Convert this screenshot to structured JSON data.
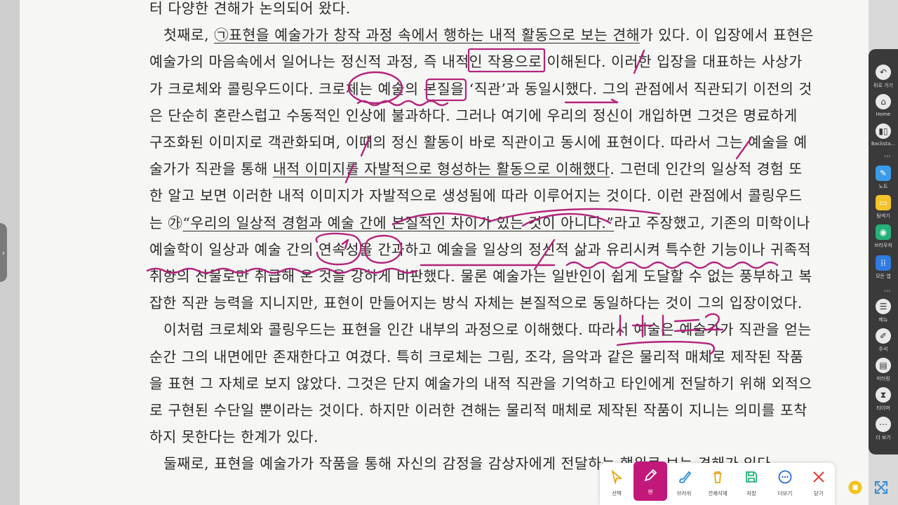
{
  "document": {
    "paragraphs": [
      {
        "id": "p0",
        "indent": false,
        "segments": [
          {
            "text": "터 다양한 견해가 논의되어 왔다."
          }
        ]
      },
      {
        "id": "p1",
        "indent": true,
        "segments": [
          {
            "text": "첫째로, "
          },
          {
            "text": "㉠표현을 예술가가 창작 과정 속에서 행하는 내적 활동으로 보는 견해",
            "underline": true
          },
          {
            "text": "가 있다. 이 입장에서 표현은 예술가의 마음속에서 일어나는 정신적 과정, 즉 내적인 작용으로 이해된다. 이러한 입장을 대표하는 사상가가 크로체와 콜링우드이다. 크로체는 예술의 본질을 ‘직관’과 동일시했다. 그의 관점에서 직관되기 이전의 것은 단순히 혼란스럽고 수동적인 인상에 불과하다. 그러나 여기에 우리의 정신이 개입하면 그것은 명료하게 구조화된 이미지로 객관화되며, 이때의 정신 활동이 바로 직관이고 동시에 표현이다. 따라서 그는 예술을 예술가가 직관을 통해 "
          },
          {
            "text": "내적 이미지를 자발적으로 형성하는 활동으로 이해했다",
            "underline": true
          },
          {
            "text": ". 그런데 인간의 일상적 경험 또한 알고 보면 이러한 내적 이미지가 자발적으로 생성됨에 따라 이루어지는 것이다. 이런 관점에서 콜링우드는 ㉮"
          },
          {
            "text": "“우리의 일상적 경험과 예술 간에 본질적인 차이가 있는 것이 아니다.”",
            "underline": true
          },
          {
            "text": "라고 주장했고, 기존의 미학이나 예술학이 일상과 예술 간의 연속성을 간과하고 예술을 일상의 정신적 삶과 유리시켜 특수한 기능이나 귀족적 취향의 산물로만 취급해 온 것을 강하게 비판했다. 물론 예술가는 일반인이 쉽게 도달할 수 없는 풍부하고 복잡한 직관 능력을 지니지만, 표현이 만들어지는 방식 자체는 본질적으로 동일하다는 것이 그의 입장이었다."
          }
        ]
      },
      {
        "id": "p2",
        "indent": true,
        "segments": [
          {
            "text": "이처럼 크로체와 콜링우드는 표현을 인간 내부의 과정으로 이해했다. 따라서 예술은 예술가가 직관을 얻는 순간 그의 내면에만 존재한다고 여겼다. 특히 크로체는 그림, 조각, 음악과 같은 물리적 매체로 제작된 작품을 표현 그 자체로 보지 않았다. 그것은 단지 예술가의 내적 직관을 기억하고 타인에게 전달하기 위해 외적으로 구현된 수단일 뿐이라는 것이다. 하지만 이러한 견해는 물리적 매체로 제작된 작품이 지니는 의미를 포착하지 못한다는 한계가 있다."
          }
        ]
      },
      {
        "id": "p3",
        "indent": true,
        "segments": [
          {
            "text": "둘째로, 표현을 예술가가 작품을 통해 자신의 감정을 감상자에게 전달하는 행위로 보는 견해가 있다."
          }
        ]
      }
    ]
  },
  "annotations": {
    "handwriting": "1+1=2"
  },
  "sidebar": {
    "items": [
      {
        "icon": "back-icon",
        "label": "뒤로 가기"
      },
      {
        "icon": "home-icon",
        "label": "Home"
      },
      {
        "icon": "backstage-icon",
        "label": "Backsta..."
      },
      {
        "icon": "note-icon",
        "label": "노트"
      },
      {
        "icon": "memo-icon",
        "label": "탐색기"
      },
      {
        "icon": "browser-icon",
        "label": "브라우저"
      },
      {
        "icon": "apps-icon",
        "label": "모든 앱"
      },
      {
        "icon": "menu-icon",
        "label": "메뉴"
      },
      {
        "icon": "annotate-icon",
        "label": "주석"
      },
      {
        "icon": "mirror-icon",
        "label": "미러링"
      },
      {
        "icon": "timer-icon",
        "label": "타이머"
      },
      {
        "icon": "more-icon",
        "label": "더 보기"
      }
    ],
    "separator": "›››"
  },
  "toolbar": {
    "items": [
      {
        "icon": "select-icon",
        "label": "선택"
      },
      {
        "icon": "pen-icon",
        "label": "펜",
        "active": true
      },
      {
        "icon": "brush-icon",
        "label": "브러쉬"
      },
      {
        "icon": "delete-all-icon",
        "label": "전체삭제"
      },
      {
        "icon": "save-icon",
        "label": "저장"
      },
      {
        "icon": "more-icon",
        "label": "더보기"
      },
      {
        "icon": "close-icon",
        "label": "닫기"
      }
    ]
  },
  "colors": {
    "ink": "#b3247c",
    "accent": "#c2187a",
    "paper": "#f6f6f4",
    "sidebar": "#3a3a3a"
  },
  "left_handle_glyph": "›"
}
